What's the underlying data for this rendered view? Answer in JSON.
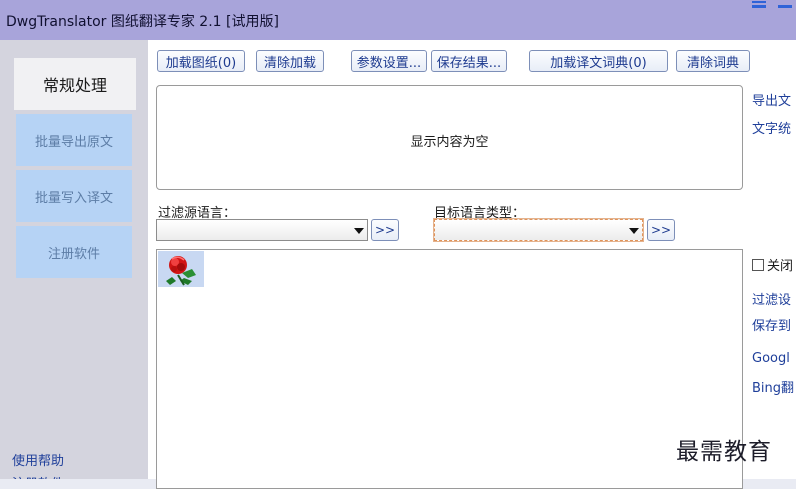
{
  "window": {
    "title": "DwgTranslator 图纸翻译专家 2.1 [试用版]"
  },
  "sidebar": {
    "items": [
      {
        "label": "常规处理",
        "active": true
      },
      {
        "label": "批量导出原文"
      },
      {
        "label": "批量写入译文"
      },
      {
        "label": "注册软件"
      }
    ],
    "help": "使用帮助",
    "help_second": "注册软件"
  },
  "toolbar": {
    "load_drawing": "加载图纸(0)",
    "clear_load": "清除加载",
    "settings": "参数设置...",
    "save_result": "保存结果...",
    "load_dict": "加载译文词典(0)",
    "clear_dict": "清除词典"
  },
  "content": {
    "empty_message": "显示内容为空"
  },
  "filters": {
    "source_label": "过滤源语言：",
    "source_value": "",
    "target_label": "目标语言类型：",
    "target_value": "",
    "go": ">>"
  },
  "right_panel": {
    "export_text": "导出文",
    "text_stats": "文字统",
    "close_checkbox": "关闭",
    "filter_settings": "过滤设",
    "save_to": "保存到",
    "google": "Googl",
    "bing": "Bing翻"
  },
  "watermark": "最需教育",
  "colors": {
    "titlebar": "#a8a4da",
    "sidebar": "#d4d4de",
    "nav_item": "#b6d3f5",
    "link": "#1f3f9a"
  }
}
